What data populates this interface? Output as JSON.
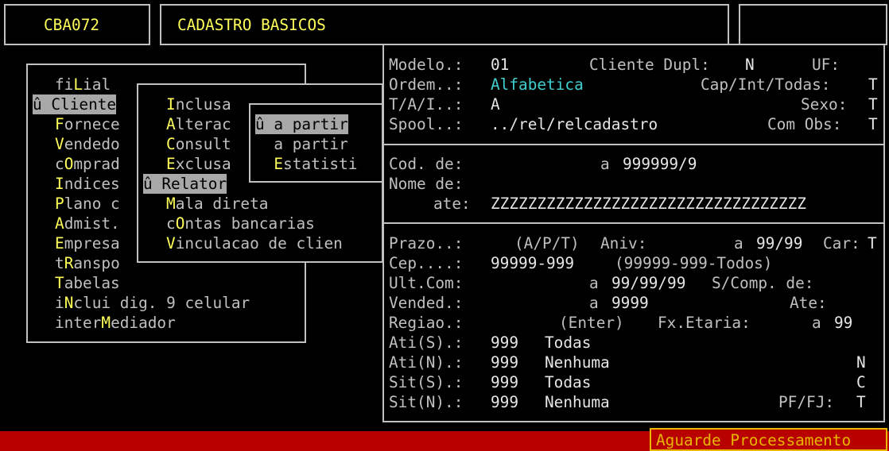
{
  "header": {
    "program_code": "CBA072",
    "title": "CADASTRO BASICOS"
  },
  "menu": {
    "items": [
      {
        "pre": "fi",
        "key": "L",
        "post": "ial"
      },
      {
        "pre": "û ",
        "key": "C",
        "post": "liente"
      },
      {
        "pre": "",
        "key": "F",
        "post": "ornece"
      },
      {
        "pre": "",
        "key": "V",
        "post": "endedo"
      },
      {
        "pre": "c",
        "key": "O",
        "post": "mprad"
      },
      {
        "pre": "",
        "key": "I",
        "post": "ndices"
      },
      {
        "pre": "",
        "key": "P",
        "post": "lano c"
      },
      {
        "pre": "",
        "key": "A",
        "post": "dmist."
      },
      {
        "pre": "",
        "key": "E",
        "post": "mpresa"
      },
      {
        "pre": "t",
        "key": "R",
        "post": "anspo"
      },
      {
        "pre": "",
        "key": "T",
        "post": "abelas"
      },
      {
        "pre": "i",
        "key": "N",
        "post": "clui dig. 9 celular"
      },
      {
        "pre": "inter",
        "key": "M",
        "post": "ediador"
      }
    ]
  },
  "submenu": {
    "items": [
      {
        "pre": "",
        "key": "I",
        "post": "nclusa"
      },
      {
        "pre": "",
        "key": "A",
        "post": "lterac"
      },
      {
        "pre": "",
        "key": "C",
        "post": "onsult"
      },
      {
        "pre": "",
        "key": "E",
        "post": "xclusa"
      },
      {
        "pre": "û ",
        "key": "R",
        "post": "elator"
      },
      {
        "pre": "",
        "key": "M",
        "post": "ala direta"
      },
      {
        "pre": "c",
        "key": "O",
        "post": "ntas bancarias"
      },
      {
        "pre": "",
        "key": "V",
        "post": "inculacao de clien"
      }
    ]
  },
  "submenu2": {
    "items": [
      {
        "pre": "û ",
        "key": "",
        "post": "a partir"
      },
      {
        "pre": "  ",
        "key": "",
        "post": "a partir"
      },
      {
        "pre": "  ",
        "key": "E",
        "post": "statisti"
      }
    ]
  },
  "form": {
    "modelo_label": "Modelo.:",
    "modelo_value": "01",
    "cliente_dupl_label": "Cliente Dupl:",
    "cliente_dupl_value": "N",
    "uf_label": "UF:",
    "ordem_label": "Ordem..:",
    "ordem_value": "Alfabetica",
    "cap_label": "Cap/Int/Todas:",
    "cap_value": "T",
    "tai_label": "T/A/I..:",
    "tai_value": "A",
    "sexo_label": "Sexo:",
    "sexo_value": "T",
    "spool_label": "Spool..:",
    "spool_value": "../rel/relcadastro",
    "com_obs_label": "Com Obs:",
    "com_obs_value": "T",
    "cod_label": "Cod. de:",
    "cod_a": "a",
    "cod_value": "999999/9",
    "nome_label": "Nome de:",
    "ate_label": "ate:",
    "ate_value": "ZZZZZZZZZZZZZZZZZZZZZZZZZZZZZZZZZZ",
    "prazo_label": "Prazo..:",
    "prazo_hint": "(A/P/T)",
    "aniv_label": "Aniv:",
    "aniv_a": "a",
    "aniv_value": "99/99",
    "car_label": "Car:",
    "car_value": "T",
    "cep_label": "Cep....:",
    "cep_value": "99999-999",
    "cep_hint": "(99999-999-Todos)",
    "ultcom_label": "Ult.Com:",
    "ultcom_a": "a",
    "ultcom_value": "99/99/99",
    "scomp_label": "S/Comp. de:",
    "vended_label": "Vended.:",
    "vended_a": "a",
    "vended_value": "9999",
    "vended_ate_label": "Ate:",
    "regiao_label": "Regiao.:",
    "regiao_hint": "(Enter)",
    "fxetaria_label": "Fx.Etaria:",
    "fxetaria_a": "a",
    "fxetaria_value": "99",
    "atis_label": "Ati(S).:",
    "atis_value": "999",
    "atis_desc": "Todas",
    "atin_label": "Ati(N).:",
    "atin_value": "999",
    "atin_desc": "Nenhuma",
    "atin_flag": "N",
    "sits_label": "Sit(S).:",
    "sits_value": "999",
    "sits_desc": "Todas",
    "sits_flag": "C",
    "sitn_label": "Sit(N).:",
    "sitn_value": "999",
    "sitn_desc": "Nenhuma",
    "pffj_label": "PF/FJ:",
    "pffj_value": "T"
  },
  "status": {
    "text": "Aguarde Processamento"
  },
  "colors": {
    "background": "#000000",
    "text": "#c0c0c0",
    "hotkey": "#ffff5a",
    "highlight": "#a8a8a8",
    "status_bar": "#b80000",
    "status_border": "#e8b800",
    "value_cyan": "#40d0d0"
  }
}
